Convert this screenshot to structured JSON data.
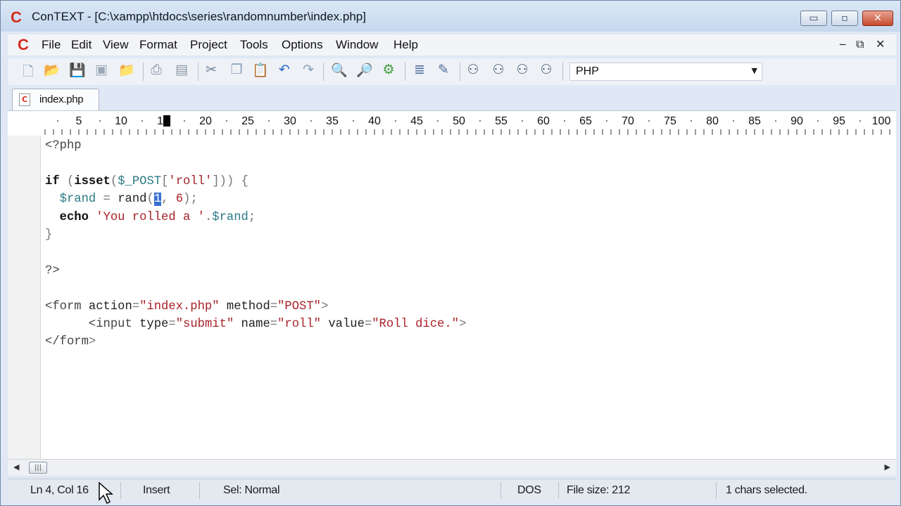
{
  "window": {
    "title": "ConTEXT - [C:\\xampp\\htdocs\\series\\randomnumber\\index.php]",
    "logo_char": "C",
    "controls": {
      "minimize": "▭",
      "maximize": "▫",
      "close": "✕"
    }
  },
  "menu": {
    "items": [
      "File",
      "Edit",
      "View",
      "Format",
      "Project",
      "Tools",
      "Options",
      "Window",
      "Help"
    ],
    "mdi_controls": [
      "‒",
      "⧉",
      "✕"
    ]
  },
  "toolbar": {
    "icons": [
      "new-file",
      "open-file",
      "save",
      "save-all",
      "open-folder",
      "print",
      "print-preview",
      "cut",
      "copy",
      "paste",
      "undo",
      "redo",
      "find",
      "find-next",
      "replace",
      "export",
      "settings",
      "user-tool-1",
      "user-tool-2",
      "user-tool-3",
      "user-tool-4"
    ],
    "highlighter_value": "PHP"
  },
  "tabs": [
    {
      "label": "index.php",
      "active": true
    }
  ],
  "ruler": {
    "labels": [
      "5",
      "10",
      "15",
      "20",
      "25",
      "30",
      "35",
      "40",
      "45",
      "50",
      "55",
      "60",
      "65",
      "70",
      "75",
      "80",
      "85",
      "90",
      "95",
      "100"
    ],
    "current_column": 16
  },
  "editor": {
    "lines": [
      "<?php",
      "",
      "if (isset($_POST['roll'])) {",
      "  $rand = rand(1, 6);",
      "  echo 'You rolled a '.$rand;",
      "}",
      "",
      "?>",
      "",
      "<form action=\"index.php\" method=\"POST\">",
      "      <input type=\"submit\" name=\"roll\" value=\"Roll dice.\">",
      "</form>"
    ],
    "selected_text": "1"
  },
  "status": {
    "position": "Ln 4, Col 16",
    "mode": "Insert",
    "selection_mode": "Sel: Normal",
    "line_endings": "DOS",
    "file_size": "File size: 212",
    "selection_info": "1 chars selected."
  },
  "colors": {
    "keyword": "#101010",
    "variable": "#2b7a85",
    "string": "#a8222a",
    "punctuation": "#777777",
    "selection": "#3a6fd1",
    "logo": "#d62b1e"
  }
}
